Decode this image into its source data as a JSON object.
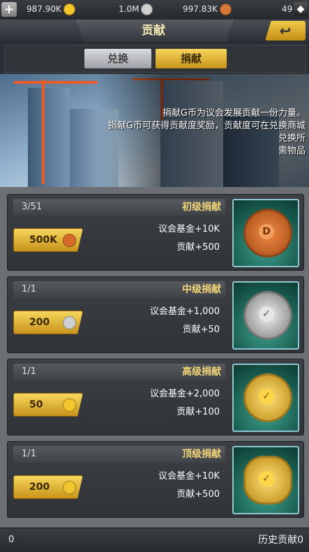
{
  "topbar": {
    "res1": "987.90K",
    "res2": "1.0M",
    "res3": "997.83K",
    "res4": "49"
  },
  "header": {
    "title": "贡献",
    "back": "↩"
  },
  "tabs": {
    "exchange": "兑换",
    "donate": "捐献"
  },
  "banner": {
    "line1": "捐献G币为议会发展贡献一份力量。",
    "line2": "捐献G币可获得贡献度奖励，贡献度可在兑换商城兑换所",
    "line3": "需物品"
  },
  "cards": [
    {
      "name": "初级捐献",
      "count": "3/51",
      "line1": "议会基金+10K",
      "line2": "贡献+500",
      "cost": "500K",
      "coin_color": "#d86a2a"
    },
    {
      "name": "中级捐献",
      "count": "1/1",
      "line1": "议会基金+1,000",
      "line2": "贡献+50",
      "cost": "200",
      "coin_color": "#c8c8c8"
    },
    {
      "name": "高级捐献",
      "count": "1/1",
      "line1": "议会基金+2,000",
      "line2": "贡献+100",
      "cost": "50",
      "coin_color": "#f2c62c"
    },
    {
      "name": "顶级捐献",
      "count": "1/1",
      "line1": "议会基金+10K",
      "line2": "贡献+500",
      "cost": "200",
      "coin_color": "#f2c62c"
    }
  ],
  "footer": {
    "label": "历史贡献0",
    "left": "0"
  }
}
